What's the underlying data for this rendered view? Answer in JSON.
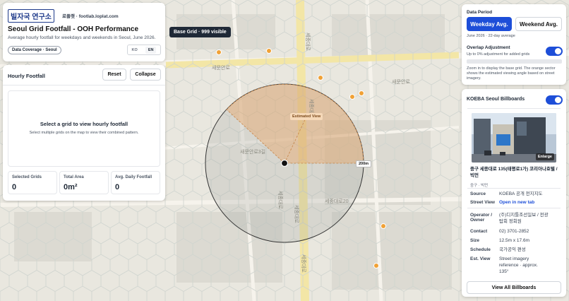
{
  "header": {
    "logo_text": "빌자국 연구소",
    "site": "로플랫 · footlab.loplat.com",
    "title": "Seoul Grid Footfall - OOH Performance",
    "subtitle": "Average hourly footfall for weekdays and weekends in Seoul, June 2026.",
    "coverage_badge": "Data Coverage · Seoul",
    "lang_ko": "KO",
    "lang_en": "EN"
  },
  "map": {
    "base_grid_tooltip": "Base Grid · 999 visible",
    "estimated_view_label": "Estimated View",
    "radius_label": "200m",
    "street_labels": [
      "새문안로",
      "세종대로",
      "세종대로",
      "새문안로3길",
      "세종대로",
      "세종대로",
      "세종대로20",
      "세종대로",
      "새문안로"
    ]
  },
  "hourly": {
    "title": "Hourly Footfall",
    "reset": "Reset",
    "collapse": "Collapse",
    "empty_title": "Select a grid to view hourly footfall",
    "empty_sub": "Select multiple grids on the map to view their combined pattern.",
    "stats": [
      {
        "label": "Selected Grids",
        "value": "0"
      },
      {
        "label": "Total Area",
        "value": "0m²"
      },
      {
        "label": "Avg. Daily Footfall",
        "value": "0"
      }
    ]
  },
  "period": {
    "title": "Data Period",
    "weekday": "Weekday Avg.",
    "weekend": "Weekend Avg.",
    "note": "June 2026 · 22-day average",
    "overlap_title": "Overlap Adjustment",
    "overlap_sub": "Up to 0% adjustment for added grids",
    "help": "Zoom in to display the base grid. The orange sector shows the estimated viewing angle based on street imagery."
  },
  "billboards": {
    "title": "KOEBA Seoul Billboards",
    "enlarge": "Enlarge",
    "address": "중구 세종대로 135(태평로1가) 코리아나호텔 / 빅먼",
    "district": "중구 · 빅먼",
    "source_label": "Source",
    "source_value": "KOEBA 공개 전지지도",
    "street_label": "Street View",
    "street_value": "Open in new tab",
    "operator_label": "Operator / Owner",
    "operator_value": "(주)디지틀조선일보 / 전광탑회 정회원",
    "contact_label": "Contact",
    "contact_value": "02) 3701-2852",
    "size_label": "Size",
    "size_value": "12.5m x 17.6m",
    "schedule_label": "Schedule",
    "schedule_value": "국가공익 편성",
    "estview_label": "Est. View",
    "estview_value": "Street imagery reference · approx. 135°",
    "view_all": "View All Billboards"
  },
  "colors": {
    "accent": "#1d4ed8",
    "sector": "#e8a96b",
    "poi": "#f0a136",
    "road": "#f3e6a6"
  }
}
